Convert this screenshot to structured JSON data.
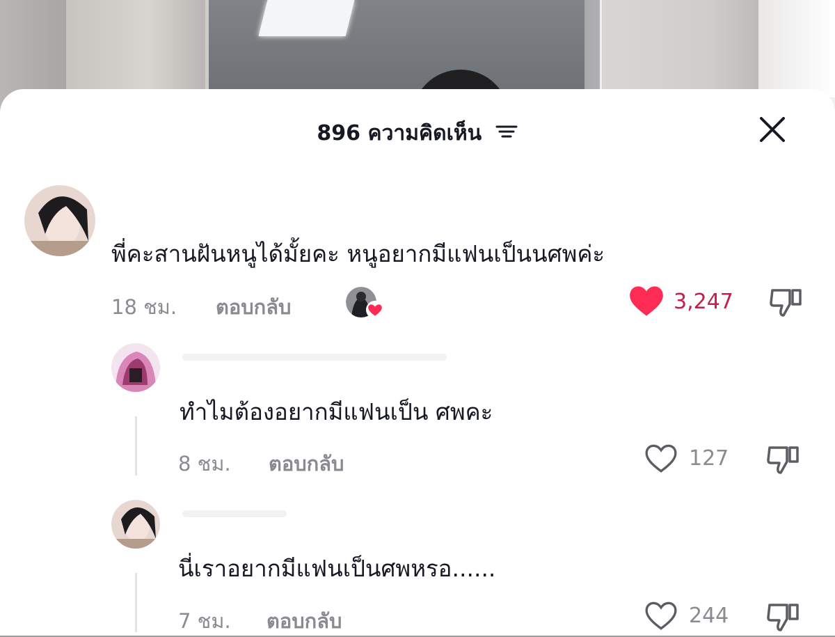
{
  "header": {
    "comment_count": "896",
    "title": "ความคิดเห็น",
    "icons": [
      "filter-icon",
      "close-icon"
    ]
  },
  "comments": [
    {
      "text": "พี่คะสานฝันหนูได้มั้ยคะ หนูอยากมีแฟนเป็นนศพค่ะ",
      "time": "18 ชม.",
      "reply_label": "ตอบกลับ",
      "likes": "3,247",
      "liked": true,
      "creator_liked": true
    },
    {
      "text": "ทำไมต้องอยากมีแฟนเป็น ศพคะ",
      "time": "8 ชม.",
      "reply_label": "ตอบกลับ",
      "likes": "127",
      "liked": false
    },
    {
      "text": "นี่เราอยากมีแฟนเป็นศพหรอ......",
      "time": "7 ชม.",
      "reply_label": "ตอบกลับ",
      "likes": "244",
      "liked": false
    }
  ],
  "colors": {
    "like_active": "#fe2c55",
    "like_count_active": "#c41f4a",
    "secondary_text": "#8a8b91",
    "primary_text": "#161823"
  }
}
